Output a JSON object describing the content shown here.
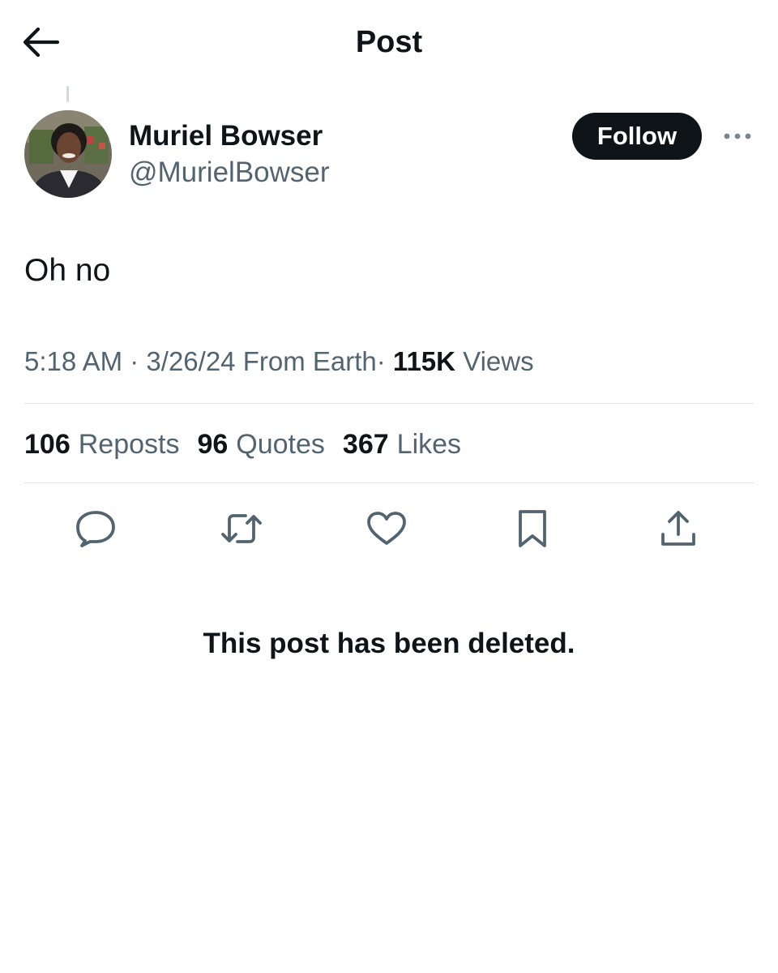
{
  "header": {
    "title": "Post",
    "back_icon": "arrow-left-icon"
  },
  "post": {
    "author": {
      "display_name": "Muriel Bowser",
      "handle": "@MurielBowser"
    },
    "follow_label": "Follow",
    "more_icon": "more-horizontal-icon",
    "text": "Oh no",
    "meta": {
      "time": "5:18 AM",
      "date": "3/26/24",
      "source": "From Earth",
      "separator": "·",
      "views_count": "115K",
      "views_label": "Views"
    },
    "stats": {
      "reposts_count": "106",
      "reposts_label": "Reposts",
      "quotes_count": "96",
      "quotes_label": "Quotes",
      "likes_count": "367",
      "likes_label": "Likes"
    },
    "actions": [
      "reply-icon",
      "repost-icon",
      "like-icon",
      "bookmark-icon",
      "share-icon"
    ]
  },
  "status_message": "This post has been deleted.",
  "colors": {
    "text_primary": "#0f1419",
    "text_secondary": "#536471",
    "divider": "#e1e6ea",
    "follow_bg": "#0f1419"
  }
}
